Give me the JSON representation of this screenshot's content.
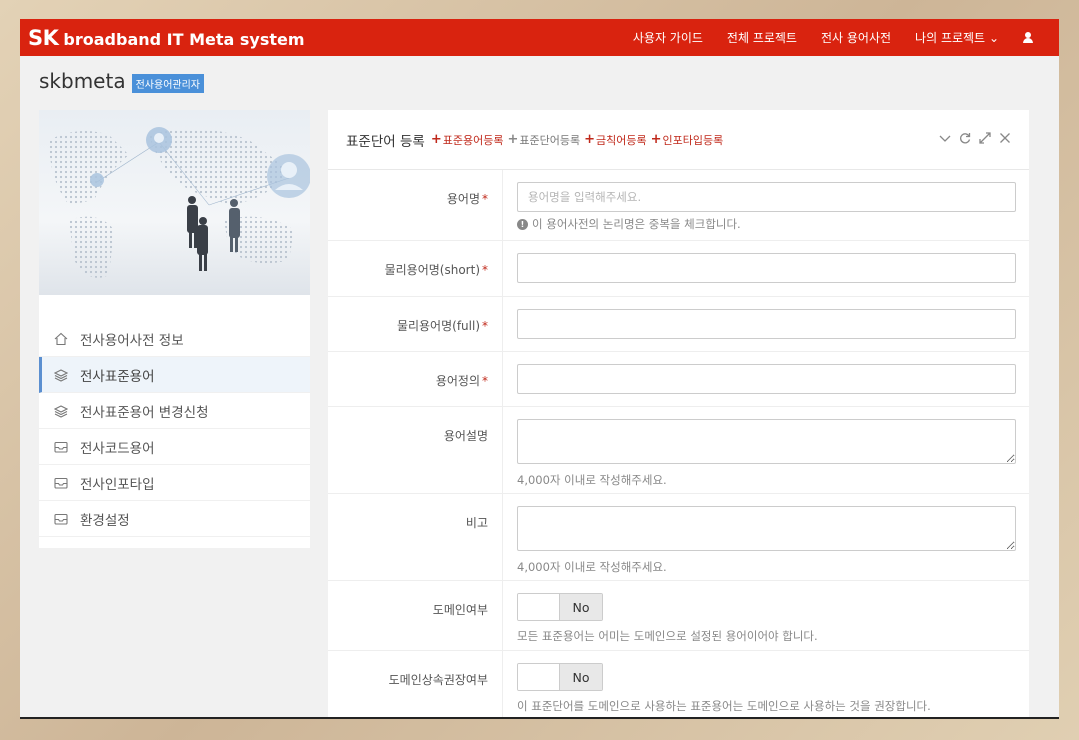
{
  "nav": {
    "brand_sk": "SK",
    "brand_rest": "broadband IT Meta system",
    "links": [
      "사용자 가이드",
      "전체 프로젝트",
      "전사 용어사전",
      "나의 프로젝트"
    ],
    "caret": "⌄"
  },
  "page": {
    "title": "skbmeta",
    "badge": "전사용어관리자"
  },
  "sidebar": {
    "items": [
      {
        "label": "전사용어사전 정보",
        "icon": "home-icon"
      },
      {
        "label": "전사표준용어",
        "icon": "layers-icon"
      },
      {
        "label": "전사표준용어 변경신청",
        "icon": "layers-icon"
      },
      {
        "label": "전사코드용어",
        "icon": "inbox-icon"
      },
      {
        "label": "전사인포타입",
        "icon": "inbox-icon"
      },
      {
        "label": "환경설정",
        "icon": "inbox-icon"
      }
    ]
  },
  "panel": {
    "title": "표준단어 등록",
    "links": [
      "표준용어등록",
      "표준단어등록",
      "금칙어등록",
      "인포타입등록"
    ]
  },
  "form": {
    "term_name": {
      "label": "용어명",
      "placeholder": "용어명을 입력해주세요.",
      "help": "이 용어사전의 논리명은 중복을 체크합니다."
    },
    "phys_short": {
      "label": "물리용어명(short)"
    },
    "phys_full": {
      "label": "물리용어명(full)"
    },
    "definition": {
      "label": "용어정의"
    },
    "description": {
      "label": "용어설명",
      "help": "4,000자 이내로 작성해주세요."
    },
    "remarks": {
      "label": "비고",
      "help": "4,000자 이내로 작성해주세요."
    },
    "domain_flag": {
      "label": "도메인여부",
      "value": "No",
      "help": "모든 표준용어는 어미는 도메인으로 설정된 용어이어야 합니다."
    },
    "domain_inherit": {
      "label": "도메인상속권장여부",
      "value": "No",
      "help": "이 표준단어를 도메인으로 사용하는 표준용어는 도메인으로 사용하는 것을 권장합니다."
    }
  },
  "colors": {
    "nav": "#d9230f",
    "accent": "#4a90d9",
    "required": "#c0291b"
  }
}
